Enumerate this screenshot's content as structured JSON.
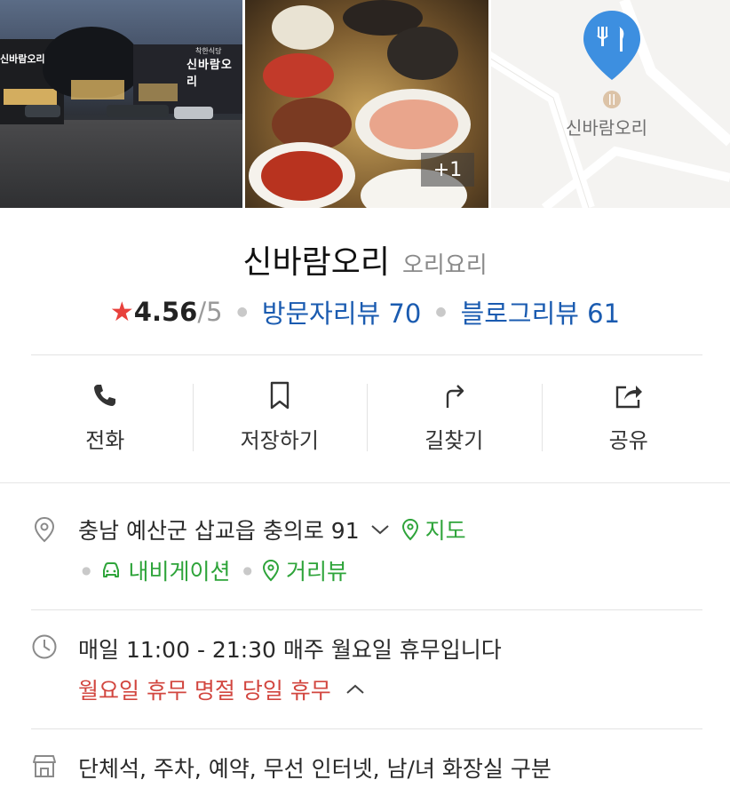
{
  "photos": {
    "photo1_sign_main": "신바람오리",
    "photo1_sign_small": "착한식당",
    "photo1_sign_left": "신바람오리",
    "more_badge": "+1",
    "map_label": "신바람오리"
  },
  "place": {
    "name": "신바람오리",
    "category": "오리요리",
    "rating": "4.56",
    "rating_max": "/5",
    "visitor_review": "방문자리뷰 70",
    "blog_review": "블로그리뷰 61"
  },
  "actions": [
    {
      "label": "전화",
      "icon": "phone-icon"
    },
    {
      "label": "저장하기",
      "icon": "bookmark-icon"
    },
    {
      "label": "길찾기",
      "icon": "directions-icon"
    },
    {
      "label": "공유",
      "icon": "share-icon"
    }
  ],
  "address": {
    "text": "충남 예산군 삽교읍 충의로 91",
    "map_link": "지도",
    "navigation_link": "내비게이션",
    "streetview_link": "거리뷰"
  },
  "hours": {
    "text": "매일 11:00 - 21:30 매주 월요일 휴무입니다",
    "closed_notice": "월요일 휴무 명절 당일 휴무"
  },
  "amenities": {
    "text": "단체석, 주차, 예약, 무선 인터넷, 남/녀 화장실 구분"
  },
  "colors": {
    "link_blue": "#1a5bb0",
    "link_green": "#2ea43a",
    "closed_red": "#d2463f",
    "star_red": "#e8413c",
    "pin_blue": "#3d8fe0"
  }
}
